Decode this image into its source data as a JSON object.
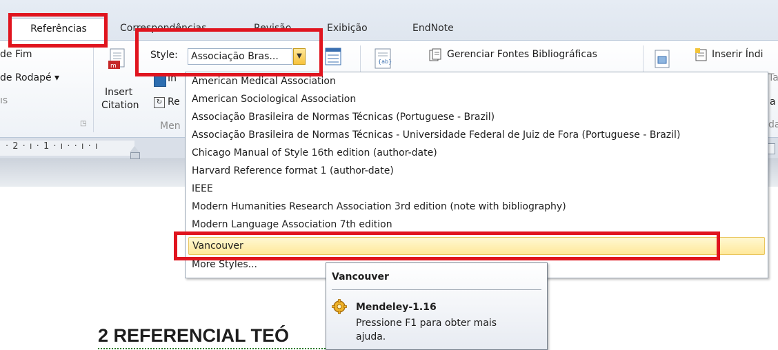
{
  "tabs": {
    "active": "Referências",
    "others": [
      "Correspondências",
      "Revisão",
      "Exibição",
      "EndNote"
    ]
  },
  "ribbon": {
    "left_col": [
      "de Fim",
      "de Rodapé ▾",
      "ıs"
    ],
    "insert_citation_label1": "Insert",
    "insert_citation_label2": "Citation",
    "in_label": "In",
    "re_label": "Re",
    "men_label": "Men",
    "style_label": "Style:",
    "style_value": "Associação Bras...",
    "gerenciar_fontes": "Gerenciar Fontes Bibliográficas",
    "inserir_indice": "Inserir Índi",
    "ta_fragment": "Ta",
    "a_fragment": "a",
    "da_fragment": "da"
  },
  "ruler": {
    "ticks": "· 2 · ı · 1 · ı ·   · ı · ı"
  },
  "style_dropdown": {
    "items": [
      "American Medical Association",
      "American Sociological Association",
      "Associação Brasileira de Normas Técnicas (Portuguese - Brazil)",
      "Associação Brasileira de Normas Técnicas - Universidade Federal de Juiz de Fora (Portuguese - Brazil)",
      "Chicago Manual of Style 16th edition (author-date)",
      "Harvard Reference format 1 (author-date)",
      "IEEE",
      "Modern Humanities Research Association 3rd edition (note with bibliography)",
      "Modern Language Association 7th edition",
      "Vancouver",
      "More Styles..."
    ],
    "highlighted_index": 9
  },
  "tooltip": {
    "title": "Vancouver",
    "plugin_name": "Mendeley-1.16",
    "help_text_line1": "Pressione F1 para obter mais",
    "help_text_line2": "ajuda."
  },
  "document": {
    "heading": "2 REFERENCIAL TEÓ"
  },
  "colors": {
    "highlight_red": "#e0141e",
    "hover_yellow": "#ffe89a",
    "ribbon_blue": "#dfe6ef"
  }
}
